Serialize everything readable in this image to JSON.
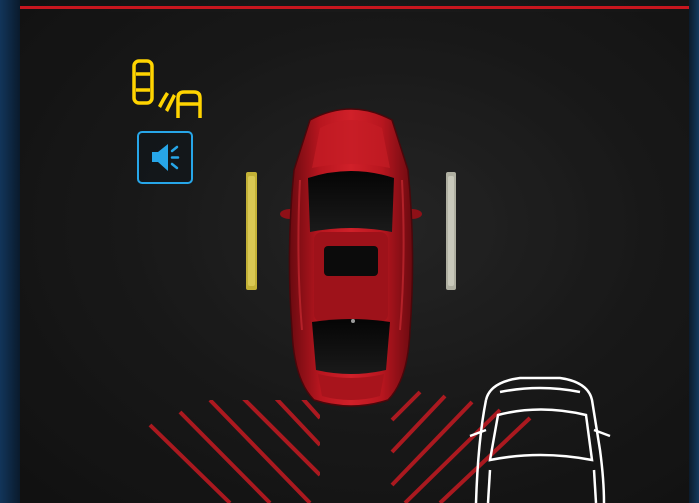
{
  "scene": {
    "description_colors": {
      "frame_accent": "#c8161e",
      "car_body": "#a8141c",
      "warning_stripes": "#d01a22",
      "lane_indicator_left": "#d6c23a",
      "lane_indicator_right": "#c9c9b8",
      "other_vehicle_outline": "#ffffff"
    }
  },
  "icons": {
    "blind_spot_monitor": {
      "name": "blind-spot-monitor-icon",
      "color": "#ffd400"
    },
    "audio_alert": {
      "name": "audio-alert-speaker-icon",
      "color": "#27a6e8"
    }
  },
  "indicators": {
    "left_lane": {
      "name": "left-lane-indicator"
    },
    "right_lane": {
      "name": "right-lane-indicator"
    },
    "rear_warning": {
      "name": "rear-cross-traffic-warning-zone"
    }
  }
}
